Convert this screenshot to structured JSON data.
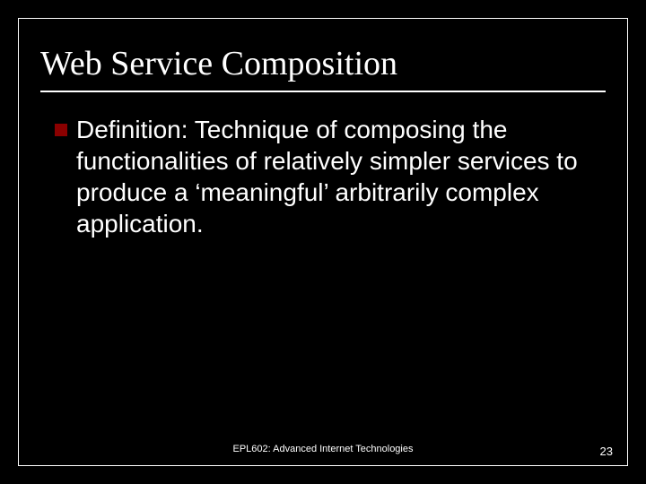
{
  "slide": {
    "title": "Web Service Composition",
    "bullets": [
      {
        "text": "Definition: Technique of composing the functionalities of relatively simpler services to produce a ‘meaningful’ arbitrarily complex application."
      }
    ],
    "footer": "EPL602: Advanced Internet Technologies",
    "page_number": "23"
  }
}
